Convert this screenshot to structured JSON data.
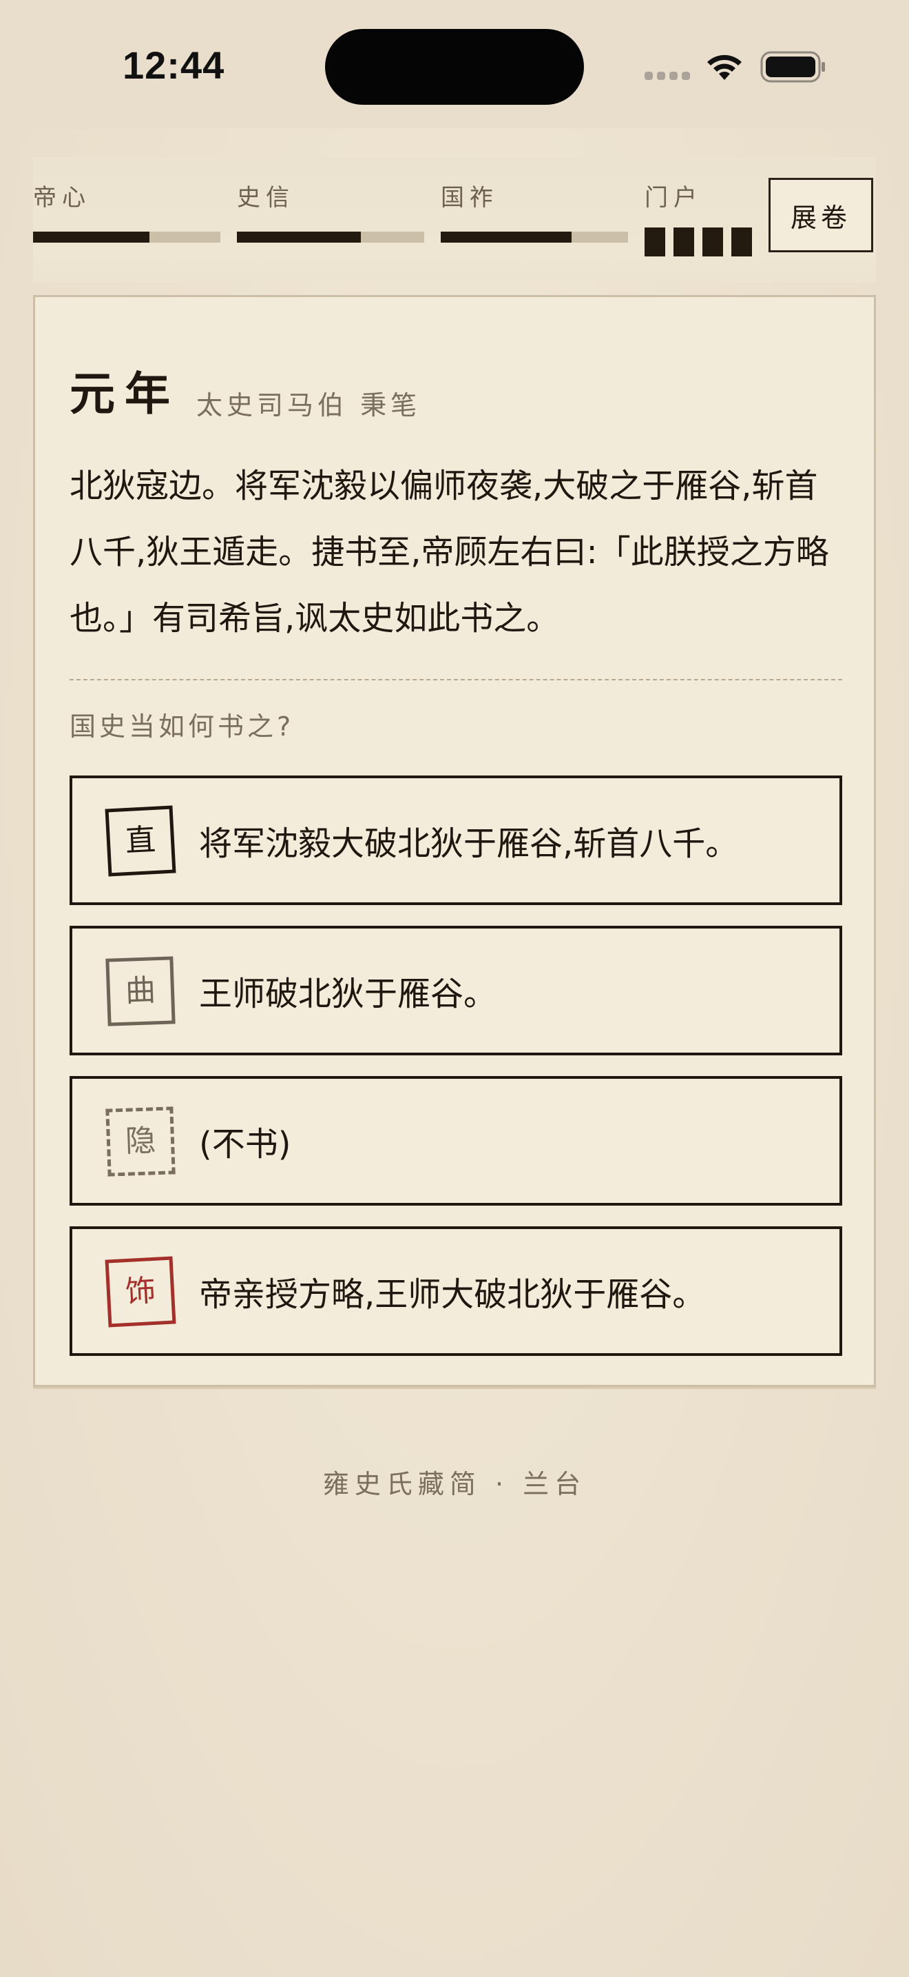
{
  "status_bar": {
    "time": "12:44"
  },
  "stats": [
    {
      "label": "帝心",
      "fill": 0.62
    },
    {
      "label": "史信",
      "fill": 0.66
    },
    {
      "label": "国祚",
      "fill": 0.7
    }
  ],
  "family": {
    "label": "门户",
    "blocks": 4
  },
  "expand_button": "展卷",
  "record": {
    "year": "元年",
    "author": "太史司马伯 秉笔",
    "event": "北狄寇边。将军沈毅以偏师夜袭,大破之于雁谷,斩首八千,狄王遁走。捷书至,帝顾左右曰:「此朕授之方略也。」有司希旨,讽太史如此书之。",
    "question": "国史当如何书之?",
    "choices": [
      {
        "seal": "直",
        "text": "将军沈毅大破北狄于雁谷,斩首八千。",
        "seal_color": "#1f1810"
      },
      {
        "seal": "曲",
        "text": "王师破北狄于雁谷。",
        "seal_color": "#6e6457"
      },
      {
        "seal": "隐",
        "text": "(不书)",
        "seal_color": "#7a6e5c"
      },
      {
        "seal": "饰",
        "text": "帝亲授方略,王师大破北狄于雁谷。",
        "seal_color": "#a3302a"
      }
    ]
  },
  "footer": "雍史氏藏简 · 兰台",
  "colors": {
    "ink": "#1f1810",
    "paper": "#f3ebda",
    "seal_red": "#a3302a"
  }
}
